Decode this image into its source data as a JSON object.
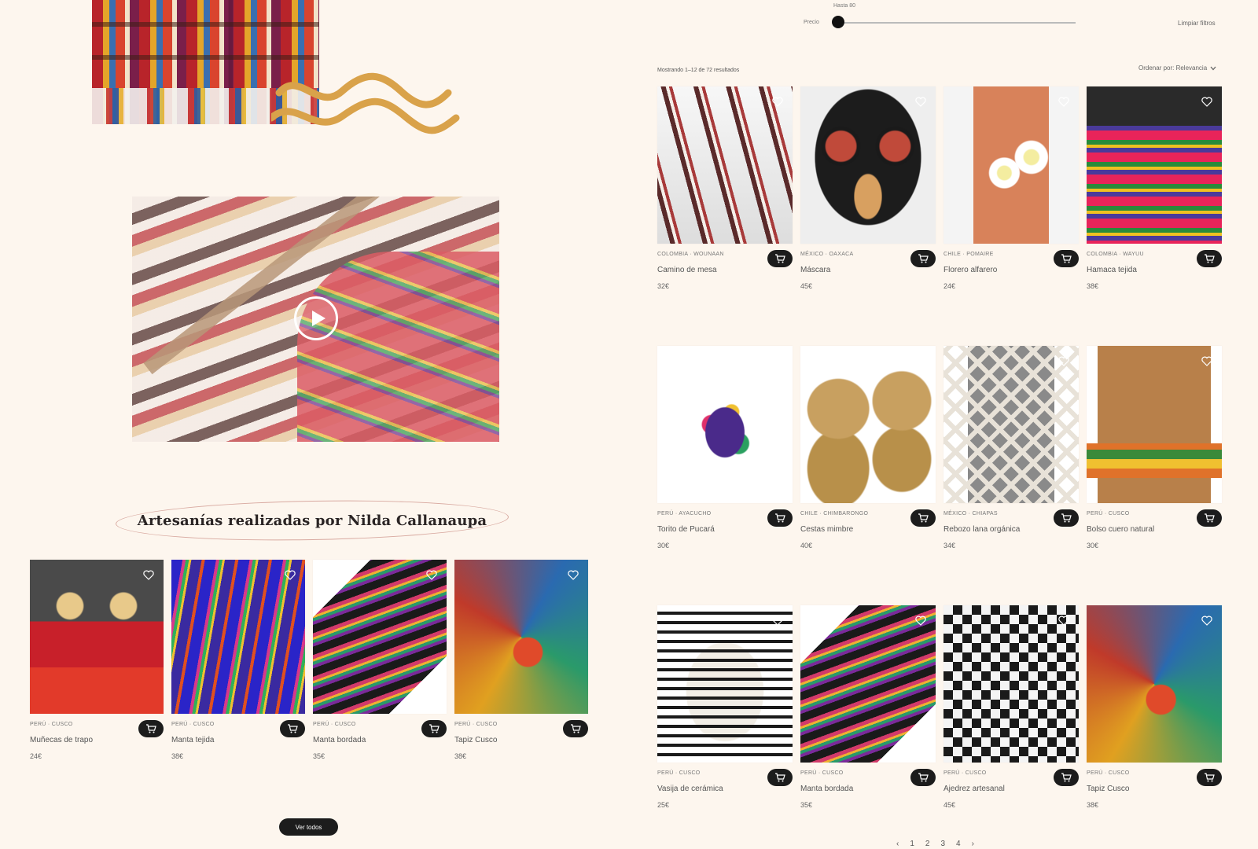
{
  "price_filter": {
    "top_label": "Hasta 80",
    "left_label": "Precio",
    "value_fraction": 0.0,
    "clear_label": "Limpiar filtros"
  },
  "results_text": "Mostrando 1–12 de 72 resultados",
  "sort_label": "Ordenar por: Relevancia",
  "sort_icon": "chevron-down-icon",
  "video": {
    "play_icon": "play-icon"
  },
  "artisan_section": {
    "title": "Artesanías realizadas por Nilda Callanaupa",
    "see_more": "Ver todos",
    "products": [
      {
        "category": "PERÚ · CUSCO",
        "name": "Muñecas de trapo",
        "price": "24€"
      },
      {
        "category": "PERÚ · CUSCO",
        "name": "Manta tejida",
        "price": "38€"
      },
      {
        "category": "PERÚ · CUSCO",
        "name": "Manta bordada",
        "price": "35€"
      },
      {
        "category": "PERÚ · CUSCO",
        "name": "Tapiz Cusco",
        "price": "38€"
      }
    ]
  },
  "grid_products": [
    {
      "category": "COLOMBIA · WOUNAAN",
      "name": "Camino de mesa",
      "price": "32€"
    },
    {
      "category": "MÉXICO · OAXACA",
      "name": "Máscara",
      "price": "45€"
    },
    {
      "category": "CHILE · POMAIRE",
      "name": "Florero alfarero",
      "price": "24€"
    },
    {
      "category": "COLOMBIA · WAYUU",
      "name": "Hamaca tejida",
      "price": "38€"
    },
    {
      "category": "PERÚ · AYACUCHO",
      "name": "Torito de Pucará",
      "price": "30€"
    },
    {
      "category": "CHILE · CHIMBARONGO",
      "name": "Cestas mimbre",
      "price": "40€"
    },
    {
      "category": "MÉXICO · CHIAPAS",
      "name": "Rebozo lana orgánica",
      "price": "34€"
    },
    {
      "category": "PERÚ · CUSCO",
      "name": "Bolso cuero natural",
      "price": "30€"
    },
    {
      "category": "PERÚ · CUSCO",
      "name": "Vasija de cerámica",
      "price": "25€"
    },
    {
      "category": "PERÚ · CUSCO",
      "name": "Manta bordada",
      "price": "35€"
    },
    {
      "category": "PERÚ · CUSCO",
      "name": "Ajedrez artesanal",
      "price": "45€"
    },
    {
      "category": "PERÚ · CUSCO",
      "name": "Tapiz Cusco",
      "price": "38€"
    }
  ],
  "pagination": {
    "prev": "‹",
    "pages": [
      "1",
      "2",
      "3",
      "4"
    ],
    "next": "›"
  },
  "icons": {
    "favorite": "heart-icon",
    "cart": "cart-icon"
  },
  "colors": {
    "background": "#fdf6ee",
    "button_dark": "#1c1c1c",
    "accent_wave": "#d9a24a"
  }
}
